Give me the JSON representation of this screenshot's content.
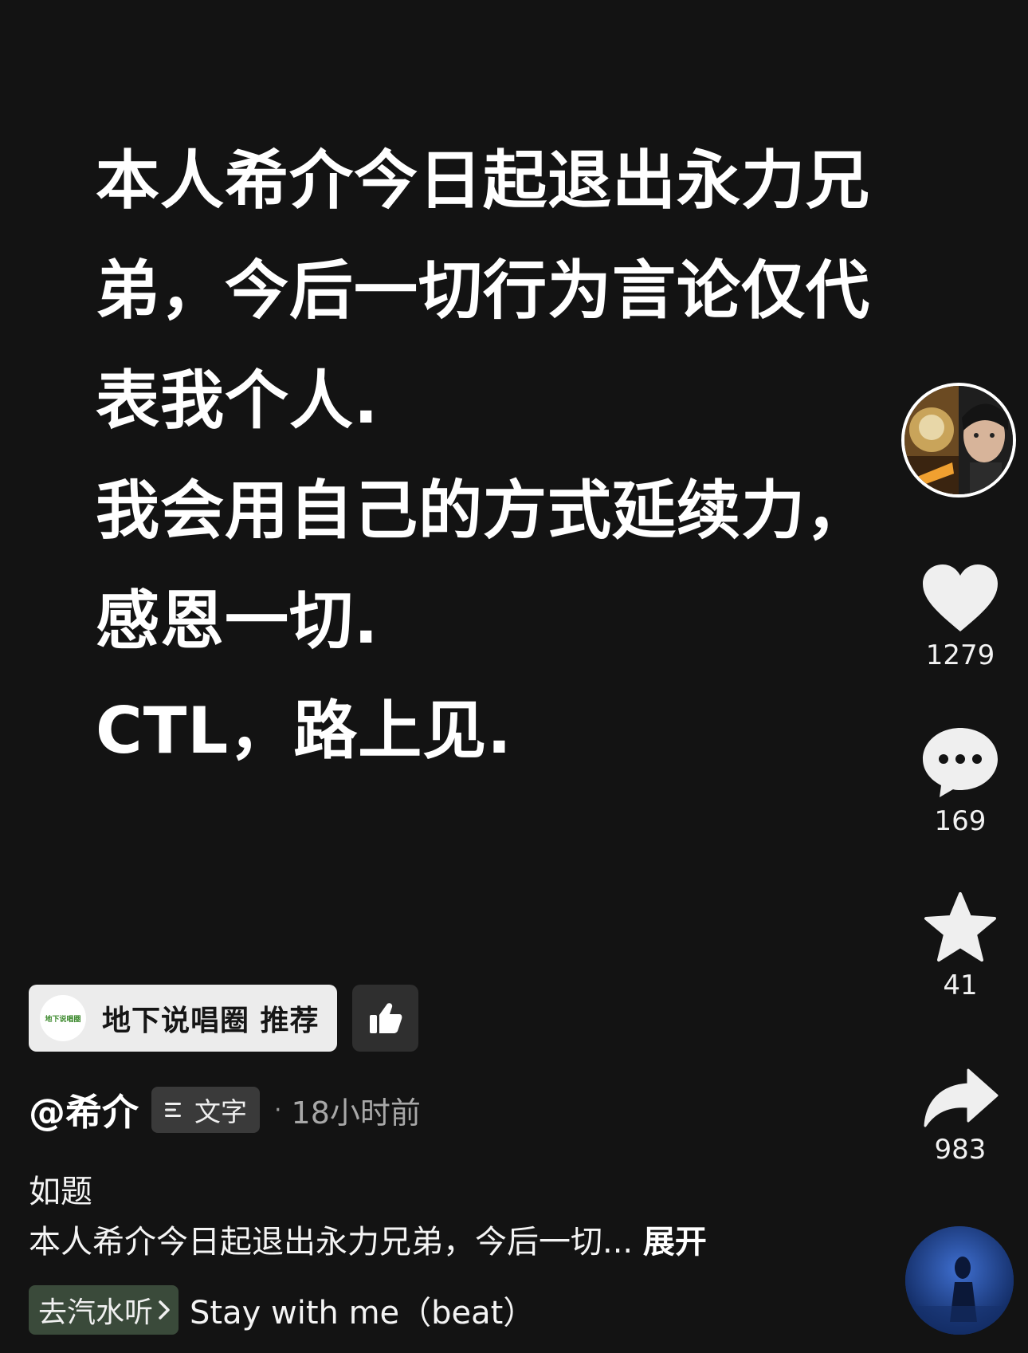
{
  "post": {
    "lines": [
      "本人希介今日起退出永力兄",
      "弟，今后一切行为言论仅代",
      "表我个人.",
      "我会用自己的方式延续力，",
      "感恩一切.",
      "CTL，路上见."
    ]
  },
  "actions": {
    "avatar_icon": "author-avatar",
    "like": {
      "icon": "heart-icon",
      "count": "1279"
    },
    "comment": {
      "icon": "comment-bubble-icon",
      "count": "169"
    },
    "favorite": {
      "icon": "star-icon",
      "count": "41"
    },
    "share": {
      "icon": "share-arrow-icon",
      "count": "983"
    },
    "music_disc_icon": "music-disc"
  },
  "recommendation": {
    "logo_text": "地下说唱圈",
    "label": "地下说唱圈  推荐",
    "thumb_icon": "thumbs-up-icon"
  },
  "author": {
    "name": "@希介",
    "tag_icon": "text-lines-icon",
    "tag_label": "文字",
    "separator": "·",
    "time": "18小时前"
  },
  "caption": {
    "title": "如题",
    "body": "本人希介今日起退出永力兄弟，今后一切...",
    "expand": "展开"
  },
  "music": {
    "chip_label": "去汽水听",
    "chip_icon": "chevron-right-icon",
    "song": "Stay with me（beat）"
  },
  "colors": {
    "background": "#131313",
    "text": "#ffffff",
    "chip_light": "#ececec",
    "chip_dark": "#3a3a3a",
    "music_chip": "#3a4a3a"
  }
}
